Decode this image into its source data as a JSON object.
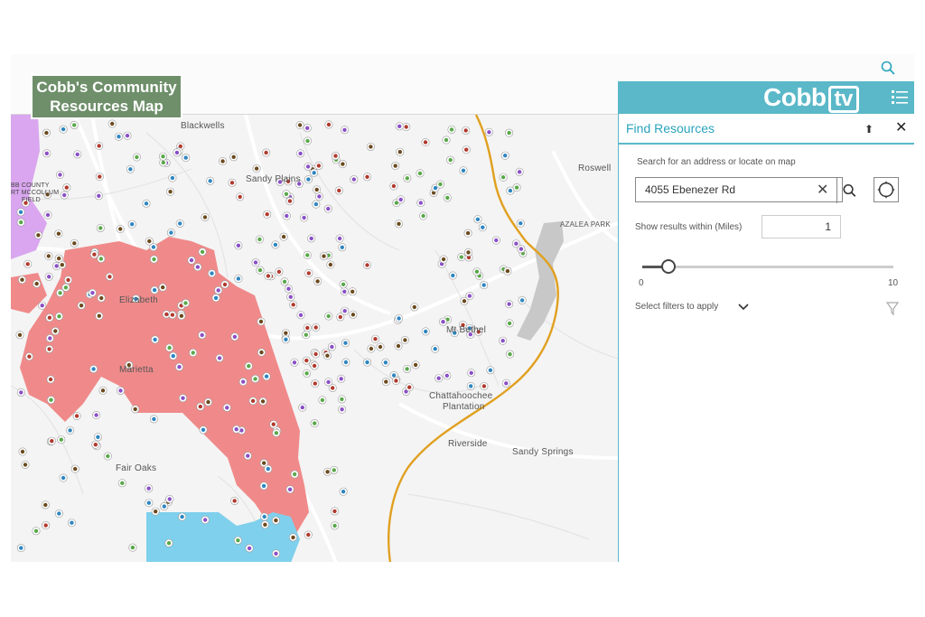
{
  "overlay_title": "Cobb's Community Resources Map",
  "brand": {
    "logo_text": "Cobb",
    "logo_badge": "tv",
    "accent": "#5ab8c8",
    "title_bg": "#6e8f6a"
  },
  "panel": {
    "title": "Find Resources",
    "search_label": "Search for an address or locate on map",
    "address_value": "4055 Ebenezer Rd",
    "within_label": "Show results within (Miles)",
    "within_value": "1",
    "slider": {
      "min_label": "0",
      "max_label": "10",
      "min": 0,
      "max": 10,
      "value": 1
    },
    "filters_label": "Select filters to apply"
  },
  "icons": [
    "search-icon",
    "list-icon",
    "collapse-icon",
    "close-icon",
    "clear-icon",
    "locate-icon",
    "chevron-down-icon",
    "filter-icon"
  ],
  "map": {
    "colors": {
      "zone_pink": "#f08a8a",
      "zone_blue": "#7fd0ec",
      "zone_lavender": "#d9a6ef",
      "boundary": "#e0a020",
      "water": "#c8c8c8",
      "road": "#ffffff"
    },
    "place_labels": [
      "Blackwells",
      "Sandy Plains",
      "Roswell",
      "AZALEA PARK",
      "Elizabeth",
      "Marietta",
      "Mt Bethel",
      "Chattahoochee",
      "Plantation",
      "Riverside",
      "Sandy Springs",
      "Fair Oaks"
    ],
    "airport_label": [
      "BB COUNTY",
      "RT MCCOLLUM",
      "FIELD"
    ]
  }
}
